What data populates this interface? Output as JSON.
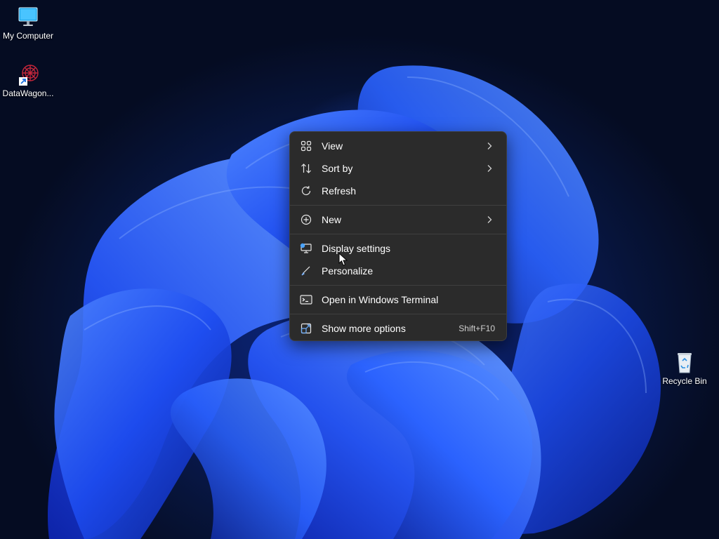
{
  "desktop": {
    "icons": [
      {
        "label": "My Computer",
        "icon": "monitor-icon"
      },
      {
        "label": "DataWagon...",
        "icon": "datawagon-shortcut-icon"
      },
      {
        "label": "Recycle Bin",
        "icon": "recycle-bin-icon"
      }
    ]
  },
  "context_menu": {
    "items": [
      {
        "label": "View",
        "icon": "grid-icon",
        "submenu": true
      },
      {
        "label": "Sort by",
        "icon": "sort-arrows-icon",
        "submenu": true
      },
      {
        "label": "Refresh",
        "icon": "refresh-icon",
        "submenu": false
      },
      {
        "label": "New",
        "icon": "plus-circle-icon",
        "submenu": true
      },
      {
        "label": "Display settings",
        "icon": "display-settings-icon",
        "submenu": false
      },
      {
        "label": "Personalize",
        "icon": "brush-icon",
        "submenu": false
      },
      {
        "label": "Open in Windows Terminal",
        "icon": "terminal-icon",
        "submenu": false
      },
      {
        "label": "Show more options",
        "icon": "expand-icon",
        "submenu": false,
        "shortcut": "Shift+F10"
      }
    ]
  },
  "colors": {
    "menu_background": "#2b2b2b",
    "menu_text": "#ffffff",
    "wallpaper_accent": "#2a5cff"
  }
}
